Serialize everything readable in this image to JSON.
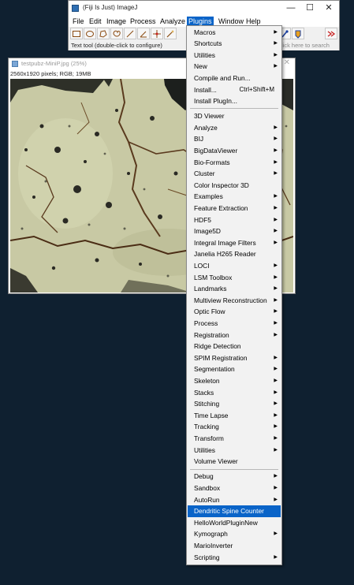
{
  "main_window": {
    "title": "(Fiji Is Just) ImageJ",
    "controls": {
      "minimize": "—",
      "maximize": "☐",
      "close": "✕"
    },
    "menubar": [
      "File",
      "Edit",
      "Image",
      "Process",
      "Analyze",
      "Plugins",
      "Window",
      "Help"
    ],
    "active_menu": "Plugins",
    "status_text": "Text tool (double-click to configure)",
    "status_right": "lick here to search",
    "toolbar": [
      "rectangle-tool-icon",
      "oval-tool-icon",
      "polygon-tool-icon",
      "freehand-tool-icon",
      "line-tool-icon",
      "angle-tool-icon",
      "point-tool-icon",
      "wand-tool-icon",
      "dropper-tool-icon",
      "color-tool-icon",
      "more-tools-icon"
    ]
  },
  "image_window": {
    "title": "testpubz-MiniP.jpg (25%)",
    "info": "2560x1920 pixels; RGB; 19MB",
    "close": "✕"
  },
  "plugins_menu": {
    "groups": [
      [
        {
          "label": "Macros",
          "submenu": true
        },
        {
          "label": "Shortcuts",
          "submenu": true
        },
        {
          "label": "Utilities",
          "submenu": true
        },
        {
          "label": "New",
          "submenu": true
        },
        {
          "label": "Compile and Run...",
          "submenu": false
        },
        {
          "label": "Install...",
          "submenu": false,
          "shortcut": "Ctrl+Shift+M"
        },
        {
          "label": "Install PlugIn...",
          "submenu": false
        }
      ],
      [
        {
          "label": "3D Viewer",
          "submenu": false
        },
        {
          "label": "Analyze",
          "submenu": true
        },
        {
          "label": "BIJ",
          "submenu": true
        },
        {
          "label": "BigDataViewer",
          "submenu": true
        },
        {
          "label": "Bio-Formats",
          "submenu": true
        },
        {
          "label": "Cluster",
          "submenu": true
        },
        {
          "label": "Color Inspector 3D",
          "submenu": false
        },
        {
          "label": "Examples",
          "submenu": true
        },
        {
          "label": "Feature Extraction",
          "submenu": true
        },
        {
          "label": "HDF5",
          "submenu": true
        },
        {
          "label": "Image5D",
          "submenu": true
        },
        {
          "label": "Integral Image Filters",
          "submenu": true
        },
        {
          "label": "Janelia H265 Reader",
          "submenu": false
        },
        {
          "label": "LOCI",
          "submenu": true
        },
        {
          "label": "LSM Toolbox",
          "submenu": true
        },
        {
          "label": "Landmarks",
          "submenu": true
        },
        {
          "label": "Multiview Reconstruction",
          "submenu": true
        },
        {
          "label": "Optic Flow",
          "submenu": true
        },
        {
          "label": "Process",
          "submenu": true
        },
        {
          "label": "Registration",
          "submenu": true
        },
        {
          "label": "Ridge Detection",
          "submenu": false
        },
        {
          "label": "SPIM Registration",
          "submenu": true
        },
        {
          "label": "Segmentation",
          "submenu": true
        },
        {
          "label": "Skeleton",
          "submenu": true
        },
        {
          "label": "Stacks",
          "submenu": true
        },
        {
          "label": "Stitching",
          "submenu": true
        },
        {
          "label": "Time Lapse",
          "submenu": true
        },
        {
          "label": "Tracking",
          "submenu": true
        },
        {
          "label": "Transform",
          "submenu": true
        },
        {
          "label": "Utilities",
          "submenu": true
        },
        {
          "label": "Volume Viewer",
          "submenu": false
        }
      ],
      [
        {
          "label": "Debug",
          "submenu": true
        },
        {
          "label": "Sandbox",
          "submenu": true
        },
        {
          "label": "AutoRun",
          "submenu": true
        },
        {
          "label": "Dendritic Spine Counter",
          "submenu": false,
          "highlighted": true
        },
        {
          "label": "HelloWorldPluginNew",
          "submenu": false
        },
        {
          "label": "Kymograph",
          "submenu": true
        },
        {
          "label": "MarioInverter",
          "submenu": false
        },
        {
          "label": "Scripting",
          "submenu": true
        }
      ]
    ]
  },
  "colors": {
    "desktop": "#0f2030",
    "highlight": "#0a64c8",
    "image_base": "#c9caa6"
  }
}
